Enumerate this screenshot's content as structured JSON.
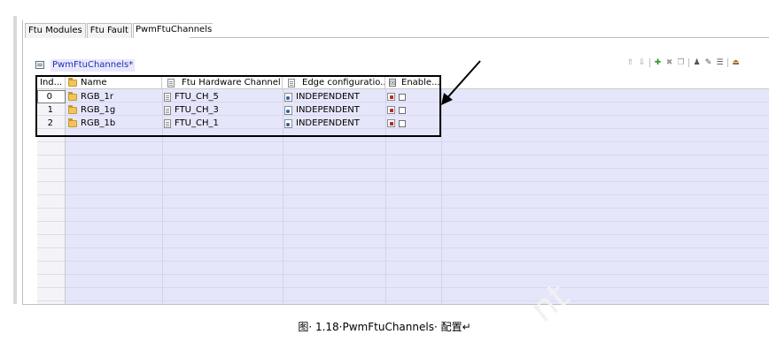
{
  "tabs": [
    {
      "label": "Ftu Modules",
      "active": false
    },
    {
      "label": "Ftu Fault",
      "active": false
    },
    {
      "label": "PwmFtuChannels",
      "active": true
    }
  ],
  "section": {
    "title": "PwmFtuChannels*",
    "icon": "table-icon"
  },
  "toolbar": {
    "icons": [
      "move-up-icon",
      "move-down-icon",
      "add-icon",
      "delete-icon",
      "copy-icon",
      "person-icon",
      "edit-icon",
      "list-icon",
      "export-icon"
    ]
  },
  "table": {
    "columns": [
      "Ind...",
      "Name",
      "Ftu Hardware Channel",
      "Edge configuratio...",
      "Enable..."
    ],
    "rows": [
      {
        "index": "0",
        "name": "RGB_1r",
        "channel": "FTU_CH_5",
        "edge": "INDEPENDENT",
        "enable": false
      },
      {
        "index": "1",
        "name": "RGB_1g",
        "channel": "FTU_CH_3",
        "edge": "INDEPENDENT",
        "enable": false
      },
      {
        "index": "2",
        "name": "RGB_1b",
        "channel": "FTU_CH_1",
        "edge": "INDEPENDENT",
        "enable": false
      }
    ]
  },
  "caption": "图· 1.18·PwmFtuChannels· 配置↵",
  "colors": {
    "row_bg": "#e6e6fb",
    "title_color": "#1f2fa8"
  }
}
